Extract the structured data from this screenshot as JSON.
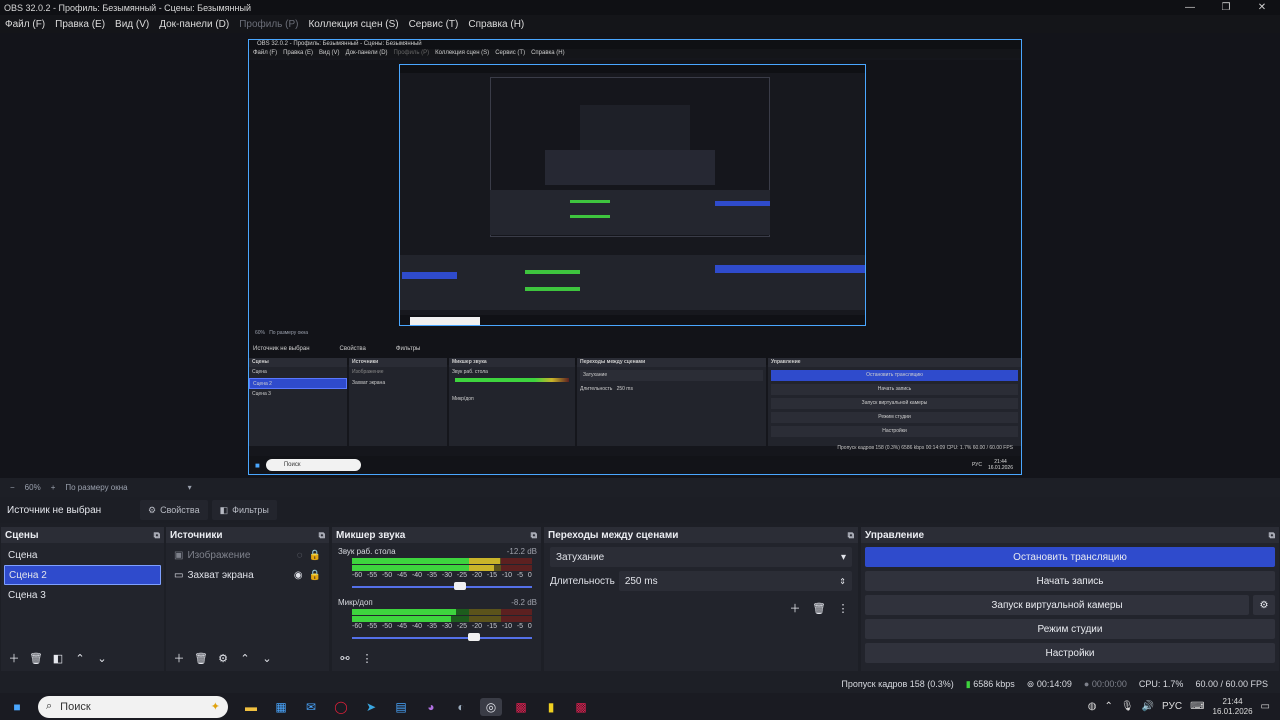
{
  "window": {
    "title": "OBS 32.0.2 - Профиль: Безымянный - Сцены: Безымянный",
    "controls": [
      "—",
      "❐",
      "✕"
    ]
  },
  "menu": {
    "items": [
      {
        "label": "Файл (F)",
        "disabled": false
      },
      {
        "label": "Правка (E)",
        "disabled": false
      },
      {
        "label": "Вид (V)",
        "disabled": false
      },
      {
        "label": "Док-панели (D)",
        "disabled": false
      },
      {
        "label": "Профиль (P)",
        "disabled": true
      },
      {
        "label": "Коллекция сцен (S)",
        "disabled": false
      },
      {
        "label": "Сервис (T)",
        "disabled": false
      },
      {
        "label": "Справка (H)",
        "disabled": false
      }
    ]
  },
  "nested": {
    "title": "OBS 32.0.2 - Профиль: Безымянный - Сцены: Безымянный",
    "menu": [
      "Файл (F)",
      "Правка (E)",
      "Вид (V)",
      "Док-панели (D)",
      "Профиль (P)",
      "Коллекция сцен (S)",
      "Сервис (T)",
      "Справка (H)"
    ],
    "zoom": "60%",
    "fit": "По размеру окна",
    "no_source": "Источник не выбран",
    "props": "Свойства",
    "filters": "Фильтры",
    "scenes_h": "Сцены",
    "scenes": [
      "Сцена",
      "Сцена 2",
      "Сцена 3"
    ],
    "sources_h": "Источники",
    "sources": [
      "Изображение",
      "Захват экрана"
    ],
    "mixer_h": "Микшер звука",
    "mixer_ch1": "Звук раб. стола",
    "mixer_ch2": "Микр/доп",
    "trans_h": "Переходы между сценами",
    "trans": "Затухание",
    "dur_label": "Длительность",
    "dur": "250 ms",
    "ctl_h": "Управление",
    "ctl": [
      "Остановить трансляцию",
      "Начать запись",
      "Запуск виртуальной камеры",
      "Режим студии",
      "Настройки"
    ],
    "status": "Пропуск кадров 158 (0.3%)   6586 kbps   00:14:09   CPU: 1.7%   60.00 / 60.00 FPS",
    "search": "Поиск",
    "clock_time": "21:44",
    "clock_date": "16.01.2026",
    "lang": "РУС"
  },
  "zoombar": {
    "minus": "−",
    "zoom": "60%",
    "plus": "+",
    "fit": "По размеру окна"
  },
  "source_bar": {
    "no_source": "Источник не выбран",
    "properties": "Свойства",
    "filters": "Фильтры"
  },
  "scenes": {
    "header": "Сцены",
    "items": [
      "Сцена",
      "Сцена 2",
      "Сцена 3"
    ],
    "selected": 1
  },
  "sources": {
    "header": "Источники",
    "items": [
      {
        "label": "Изображение",
        "hidden": true
      },
      {
        "label": "Захват экрана",
        "hidden": false
      }
    ]
  },
  "mixer": {
    "header": "Микшер звука",
    "ticks": [
      "-60",
      "-55",
      "-50",
      "-45",
      "-40",
      "-35",
      "-30",
      "-25",
      "-20",
      "-15",
      "-10",
      "-5",
      "0"
    ],
    "channels": [
      {
        "name": "Звук раб. стола",
        "db": "-12.2 dB",
        "level": 0.82,
        "volume": 0.6
      },
      {
        "name": "Микр/доп",
        "db": "-8.2 dB",
        "level": 0.58,
        "volume": 0.68
      }
    ]
  },
  "transitions": {
    "header": "Переходы между сценами",
    "type": "Затухание",
    "duration_label": "Длительность",
    "duration": "250 ms"
  },
  "controls": {
    "header": "Управление",
    "buttons": [
      "Остановить трансляцию",
      "Начать запись",
      "Запуск виртуальной камеры",
      "Режим студии",
      "Настройки"
    ]
  },
  "status": {
    "dropped": "Пропуск кадров 158 (0.3%)",
    "bitrate": "6586 kbps",
    "stream_time": "00:14:09",
    "rec_time": "00:00:00",
    "cpu": "CPU: 1.7%",
    "fps": "60.00 / 60.00 FPS"
  },
  "taskbar": {
    "search": "Поиск",
    "lang": "РУС",
    "time": "21:44",
    "date": "16.01.2026"
  },
  "colors": {
    "accent": "#2f4bcc",
    "preview_border": "#4aa7ff",
    "meter_green": "#3ed43e",
    "meter_yellow": "#c9b42a",
    "meter_red": "#c43333"
  }
}
